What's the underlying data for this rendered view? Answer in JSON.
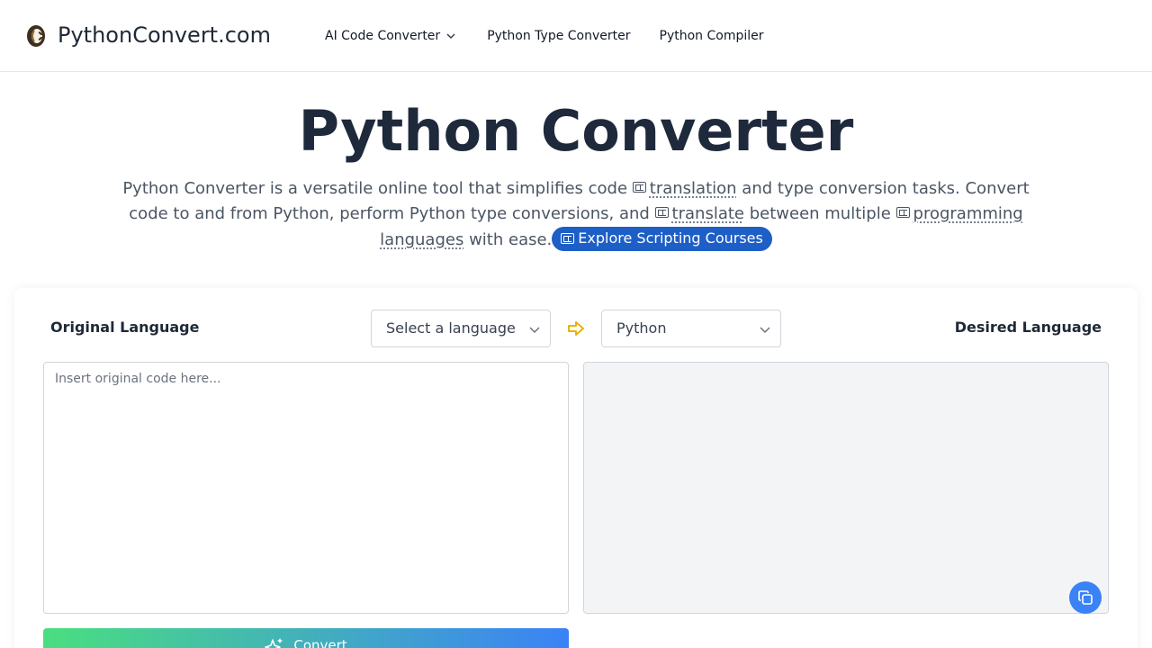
{
  "header": {
    "brand": "PythonConvert.com",
    "nav": [
      {
        "label": "AI Code Converter",
        "has_dropdown": true
      },
      {
        "label": "Python Type Converter"
      },
      {
        "label": "Python Compiler"
      }
    ]
  },
  "hero": {
    "title": "Python Converter",
    "desc_part1": "Python Converter is a versatile online tool that simplifies code",
    "link1": "translation",
    "desc_part2": "and type conversion tasks. Convert code to and from Python, perform Python type conversions, and",
    "link2": "translate",
    "desc_part3": "between multiple",
    "link3": "programming languages",
    "desc_part4": "with ease.",
    "cta": "Explore Scripting Courses"
  },
  "converter": {
    "original_label": "Original Language",
    "desired_label": "Desired Language",
    "source_select": "Select a language",
    "target_select": "Python",
    "input_placeholder": "Insert original code here...",
    "convert_label": "Convert"
  },
  "colors": {
    "accent": "#3b82f6",
    "cta": "#1d5fc6",
    "swap_arrow": "#eab308",
    "gradient_start": "#4ade80"
  }
}
